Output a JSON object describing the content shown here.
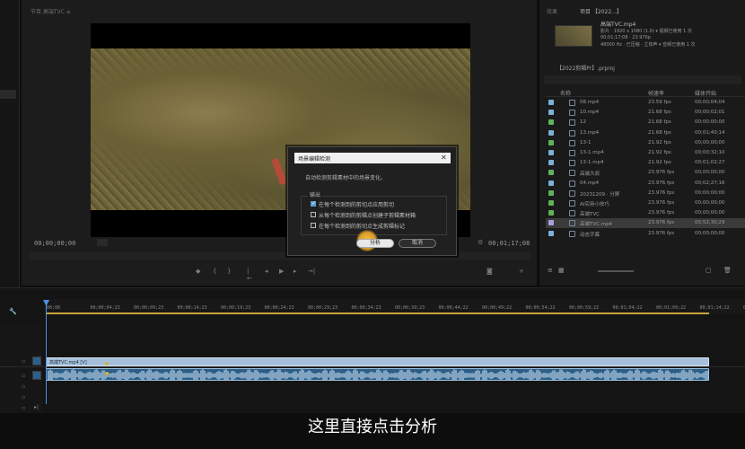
{
  "source_monitor": {
    "tab_label": "节目 高端TVC ≡"
  },
  "program": {
    "timecode_left": "00;00;00;00",
    "timecode_right": "00;01;17;08"
  },
  "project": {
    "tabs": [
      "效果",
      "项目 【2022...】"
    ],
    "clip_name": "高端TVC.mp4",
    "clip_info": [
      "影片 · 1920 x 1080 (1.0)  ▾ 视频已使用 1 次",
      "00;01;17;08 · 23.976p",
      "48000 Hz · 已压缩 · 立体声  ▾ 音频已使用 1 次"
    ],
    "project_file": "【2022剪辑Pr】.prproj",
    "columns": {
      "name": "名称",
      "fps": "帧速率",
      "start": "媒体开始"
    },
    "items": [
      {
        "name": "08.mp4",
        "fps": "23.59 fps",
        "start": "00;00;04;04",
        "color": "#7bb0d8"
      },
      {
        "name": "10.mp4",
        "fps": "21.68 fps",
        "start": "00;00;02;01",
        "color": "#7bb0d8"
      },
      {
        "name": "12",
        "fps": "21.68 fps",
        "start": "00;00;00;00",
        "color": "#5fb35a"
      },
      {
        "name": "13.mp4",
        "fps": "21.68 fps",
        "start": "00;01;40;14",
        "color": "#7bb0d8"
      },
      {
        "name": "13-1",
        "fps": "21.92 fps",
        "start": "00;00;00;00",
        "color": "#5fb35a"
      },
      {
        "name": "13-1.mp4",
        "fps": "21.92 fps",
        "start": "00;00;32;10",
        "color": "#7bb0d8"
      },
      {
        "name": "13-1.mp4",
        "fps": "21.92 fps",
        "start": "00;01;02;27",
        "color": "#7bb0d8"
      },
      {
        "name": "高端大叔",
        "fps": "23.976 fps",
        "start": "00;00;00;00",
        "color": "#5fb35a"
      },
      {
        "name": "04.mp4",
        "fps": "23.976 fps",
        "start": "00;02;27;16",
        "color": "#7bb0d8"
      },
      {
        "name": "20231209 · 分屏",
        "fps": "23.976 fps",
        "start": "00;00;00;00",
        "color": "#5fb35a"
      },
      {
        "name": "AI实用小技巧",
        "fps": "23.976 fps",
        "start": "00;00;00;00",
        "color": "#5fb35a"
      },
      {
        "name": "高端TVC",
        "fps": "23.976 fps",
        "start": "00;00;00;00",
        "color": "#5fb35a"
      },
      {
        "name": "高端TVC.mp4",
        "fps": "23.976 fps",
        "start": "00;52;30;29",
        "color": "#a8a0dc"
      },
      {
        "name": "动态字幕",
        "fps": "23.976 fps",
        "start": "00;00;00;00",
        "color": "#7bb0d8"
      }
    ]
  },
  "dialog": {
    "title": "场景编辑检测",
    "description": "自动检测剪辑素材中的场景变化。",
    "group_label": "输出",
    "options": [
      {
        "label": "在每个检测到的剪切点应用剪切",
        "checked": true
      },
      {
        "label": "从每个检测到的剪辑点创建子剪辑素材箱",
        "checked": false
      },
      {
        "label": "在每个检测到的剪切点生成剪辑标记",
        "checked": false
      }
    ],
    "analyze_button": "分析",
    "cancel_button": "取消"
  },
  "timeline": {
    "ticks": [
      "00;00",
      "00;00;04;23",
      "00;00;09;23",
      "00;00;14;23",
      "00;00;19;23",
      "00;00;24;23",
      "00;00;29;23",
      "00;00;34;23",
      "00;00;39;23",
      "00;00;44;22",
      "00;00;49;22",
      "00;00;54;22",
      "00;00;59;22",
      "00;01;04;22",
      "00;01;09;22",
      "00;01;14;22",
      "00;01;19;22"
    ],
    "video_clip": "高端TVC.mp4 [V]",
    "track_labels": [
      "V",
      "A",
      "M"
    ]
  },
  "subtitle": "这里直接点击分析",
  "colors": {
    "accent_blue": "#5a9fd6",
    "dialog_bg": "#202020",
    "playhead": "#4f8fe0",
    "cursor_halo": "#e3b431"
  }
}
